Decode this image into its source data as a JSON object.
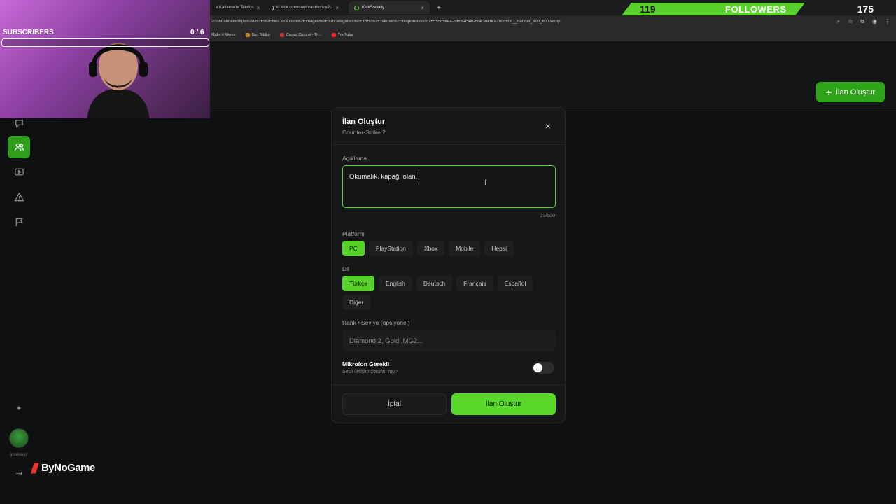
{
  "browser": {
    "tabs": [
      {
        "label": "e Katlamada Telefon",
        "active": false
      },
      {
        "label": "id.kick.com/oauth/authorize?cl",
        "active": false
      },
      {
        "label": "KickSocially",
        "active": true
      }
    ],
    "url": "202&banner=https%3A%2F%2Ffiles.kick.com%2Fimages%2Fsubcategories%2F1552%2Fbanner%2Fresponsives%2F555d5ee4-5863-4546-8c4c-6ebca28dc60d__banner_600_800.webp",
    "bookmarks": [
      "Make it Meme",
      "Ben Bildim",
      "Crowd Control - Th...",
      "YouTube"
    ]
  },
  "overlay": {
    "followers_count": "119",
    "followers_label": "FOLLOWERS",
    "followers_goal": "175",
    "subscribers_label": "SUBSCRIBERS",
    "subscribers_count": "0 / 6",
    "logo_text": "ByNoGame"
  },
  "header": {
    "create_button_label": "İlan Oluştur"
  },
  "sidebar": {
    "icons": [
      "chat-icon",
      "users-icon",
      "video-icon",
      "warning-icon",
      "flag-icon"
    ],
    "user_name": "goeksayjr"
  },
  "modal": {
    "title": "İlan Oluştur",
    "subtitle": "Counter-Strike 2",
    "close_glyph": "×",
    "description_label": "Açıklama",
    "description_value": "Okumalık, kapağı olan,",
    "description_counter": "23/500",
    "platform_label": "Platform",
    "platforms": [
      {
        "label": "PC",
        "selected": true
      },
      {
        "label": "PlayStation",
        "selected": false
      },
      {
        "label": "Xbox",
        "selected": false
      },
      {
        "label": "Mobile",
        "selected": false
      },
      {
        "label": "Hepsi",
        "selected": false
      }
    ],
    "language_label": "Dil",
    "languages": [
      {
        "label": "Türkçe",
        "selected": true
      },
      {
        "label": "English",
        "selected": false
      },
      {
        "label": "Deutsch",
        "selected": false
      },
      {
        "label": "Français",
        "selected": false
      },
      {
        "label": "Español",
        "selected": false
      },
      {
        "label": "Diğer",
        "selected": false
      }
    ],
    "rank_label": "Rank / Seviye (opsiyonel)",
    "rank_placeholder": "Diamond 2, Gold, MG2...",
    "mic_title": "Mikrofon Gerekli",
    "mic_subtitle": "Sesli iletişim zorunlu mu?",
    "mic_enabled": false,
    "cancel_label": "İptal",
    "submit_label": "İlan Oluştur"
  },
  "colors": {
    "accent": "#58d92a",
    "accent_dark": "#2fa31a",
    "modal_bg": "#161718"
  }
}
